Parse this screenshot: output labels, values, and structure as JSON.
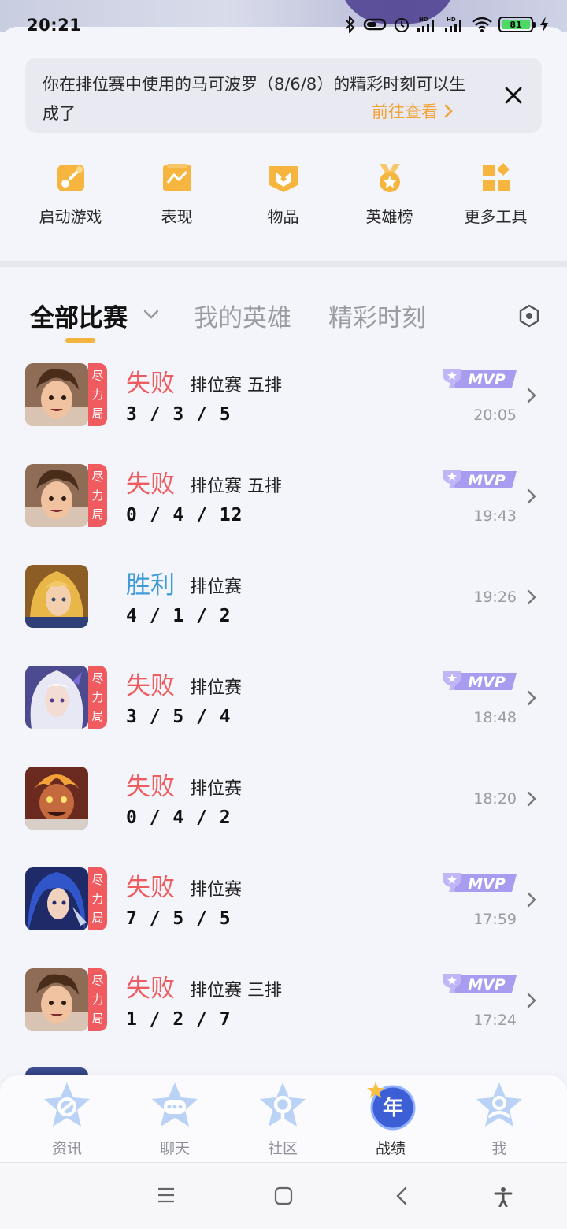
{
  "status": {
    "time": "20:21",
    "battery": "81"
  },
  "notice": {
    "text": "你在排位赛中使用的马可波罗（8/6/8）的精彩时刻可以生成了",
    "link": "前往查看",
    "link_color": "#f2a33a"
  },
  "tools": [
    {
      "label": "启动游戏",
      "icon": "gamepad-icon"
    },
    {
      "label": "表现",
      "icon": "performance-chart-icon"
    },
    {
      "label": "物品",
      "icon": "items-icon"
    },
    {
      "label": "英雄榜",
      "icon": "medal-icon"
    },
    {
      "label": "更多工具",
      "icon": "more-tools-icon"
    }
  ],
  "tabs": [
    {
      "label": "全部比赛",
      "active": true
    },
    {
      "label": "我的英雄",
      "active": false
    },
    {
      "label": "精彩时刻",
      "active": false
    }
  ],
  "matches": [
    {
      "result": "失败",
      "outcome": "lose",
      "mode": "排位赛 五排",
      "kda": "3 / 3 / 5",
      "time": "20:05",
      "mvp": true,
      "tag": "尽力局",
      "hero": "hero-marco"
    },
    {
      "result": "失败",
      "outcome": "lose",
      "mode": "排位赛 五排",
      "kda": "0 / 4 / 12",
      "time": "19:43",
      "mvp": true,
      "tag": "尽力局",
      "hero": "hero-marco"
    },
    {
      "result": "胜利",
      "outcome": "win",
      "mode": "排位赛",
      "kda": "4 / 1 / 2",
      "time": "19:26",
      "mvp": false,
      "tag": "",
      "hero": "hero-blonde"
    },
    {
      "result": "失败",
      "outcome": "lose",
      "mode": "排位赛",
      "kda": "3 / 5 / 4",
      "time": "18:48",
      "mvp": true,
      "tag": "尽力局",
      "hero": "hero-silver"
    },
    {
      "result": "失败",
      "outcome": "lose",
      "mode": "排位赛",
      "kda": "0 / 4 / 2",
      "time": "18:20",
      "mvp": false,
      "tag": "",
      "hero": "hero-fire"
    },
    {
      "result": "失败",
      "outcome": "lose",
      "mode": "排位赛",
      "kda": "7 / 5 / 5",
      "time": "17:59",
      "mvp": true,
      "tag": "尽力局",
      "hero": "hero-blue"
    },
    {
      "result": "失败",
      "outcome": "lose",
      "mode": "排位赛 三排",
      "kda": "1 / 2 / 7",
      "time": "17:24",
      "mvp": true,
      "tag": "尽力局",
      "hero": "hero-marco"
    }
  ],
  "mvp_label": "MVP",
  "bottom_nav": [
    {
      "label": "资讯",
      "icon": "news-star-icon",
      "active": false
    },
    {
      "label": "聊天",
      "icon": "chat-star-icon",
      "active": false
    },
    {
      "label": "社区",
      "icon": "community-star-icon",
      "active": false
    },
    {
      "label": "战绩",
      "icon": "record-year-icon",
      "active": true,
      "badge": "年"
    },
    {
      "label": "我",
      "icon": "profile-star-icon",
      "active": false
    }
  ],
  "colors": {
    "lose": "#ee5c60",
    "win": "#3f9ad8",
    "accent": "#f2b43e",
    "mvp": "#8d7de0"
  }
}
